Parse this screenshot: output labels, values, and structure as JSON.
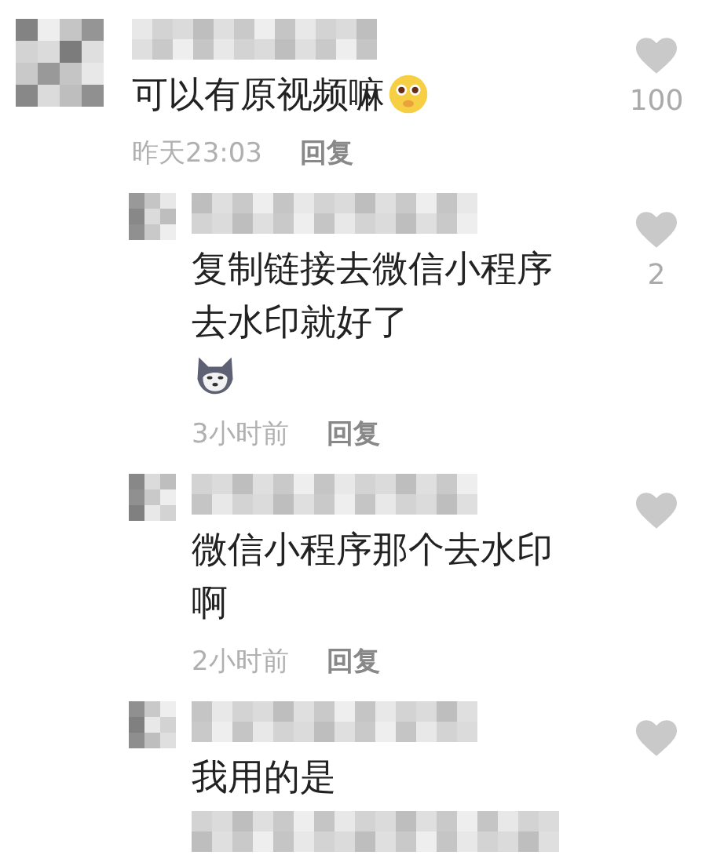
{
  "comment": {
    "text": "可以有原视频嘛",
    "emoji": {
      "kind": "pleading"
    },
    "likes": "100",
    "time": "昨天23:03",
    "reply_label": "回复",
    "replies": [
      {
        "text": "复制链接去微信小程序去水印就好了",
        "emoji": {
          "kind": "wolf"
        },
        "likes": "2",
        "time": "3小时前",
        "reply_label": "回复"
      },
      {
        "text": "微信小程序那个去水印啊",
        "time": "2小时前",
        "reply_label": "回复"
      },
      {
        "text": "我用的是"
      }
    ]
  }
}
